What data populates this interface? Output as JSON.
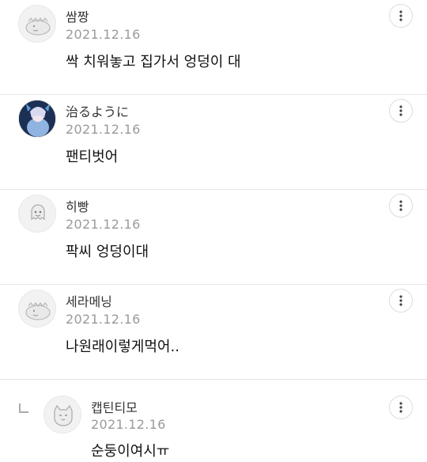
{
  "comments": [
    {
      "nickname": "쌈짱",
      "date": "2021.12.16",
      "text": "싹 치워놓고 집가서 엉덩이 대",
      "avatar": "dino-default-avatar"
    },
    {
      "nickname": "治るように",
      "date": "2021.12.16",
      "text": "팬티벗어",
      "avatar": "anime-character-avatar"
    },
    {
      "nickname": "히빵",
      "date": "2021.12.16",
      "text": "팍씨 엉덩이대",
      "avatar": "ghost-default-avatar"
    },
    {
      "nickname": "세라메닝",
      "date": "2021.12.16",
      "text": "나원래이렇게먹어..",
      "avatar": "dino-default-avatar"
    }
  ],
  "reply": {
    "nickname": "캡틴티모",
    "date": "2021.12.16",
    "text": "순둥이여시ㅠ",
    "avatar": "cat-default-avatar"
  },
  "more_icon": "vertical-ellipsis-icon",
  "colors": {
    "divider": "#e6e6e6",
    "date": "#9a9a9a"
  }
}
